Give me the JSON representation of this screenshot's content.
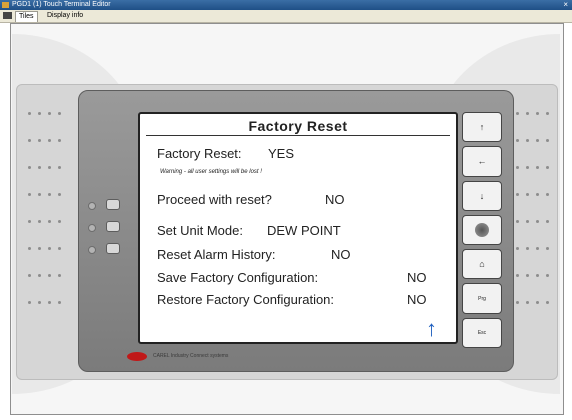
{
  "window": {
    "title": "PGD1 (1) Touch Terminal Editor",
    "close_glyph": "×"
  },
  "menu": {
    "tabs": [
      "Tiles",
      "Display info"
    ]
  },
  "screen": {
    "title": "Factory Reset",
    "lines": [
      {
        "label": "Factory Reset:",
        "value": "YES"
      },
      {
        "label": "Proceed with reset?",
        "value": "NO"
      },
      {
        "label": "Set Unit Mode:",
        "value": "DEW POINT"
      },
      {
        "label": "Reset Alarm History:",
        "value": "NO"
      },
      {
        "label": "Save Factory Configuration:",
        "value": "NO"
      },
      {
        "label": "Restore Factory Configuration:",
        "value": "NO"
      }
    ],
    "warning": "Warning - all user settings will be lost !",
    "nav_icon": "up-arrow-icon",
    "nav_glyph": "↑"
  },
  "keypad": [
    {
      "icon": "up-arrow-icon",
      "glyph": "↑"
    },
    {
      "icon": "enter-arrow-icon",
      "glyph": "←"
    },
    {
      "icon": "down-arrow-icon",
      "glyph": "↓"
    },
    {
      "icon": "alarm-icon",
      "glyph": ""
    },
    {
      "icon": "home-icon",
      "glyph": "⌂"
    },
    {
      "icon": "prg-key",
      "glyph": "Prg"
    },
    {
      "icon": "esc-key",
      "glyph": "Esc"
    }
  ],
  "brand": {
    "text": "CAREL  Industry Connect systems"
  },
  "colors": {
    "accent": "#1f5fbf",
    "brand": "#c01818"
  }
}
